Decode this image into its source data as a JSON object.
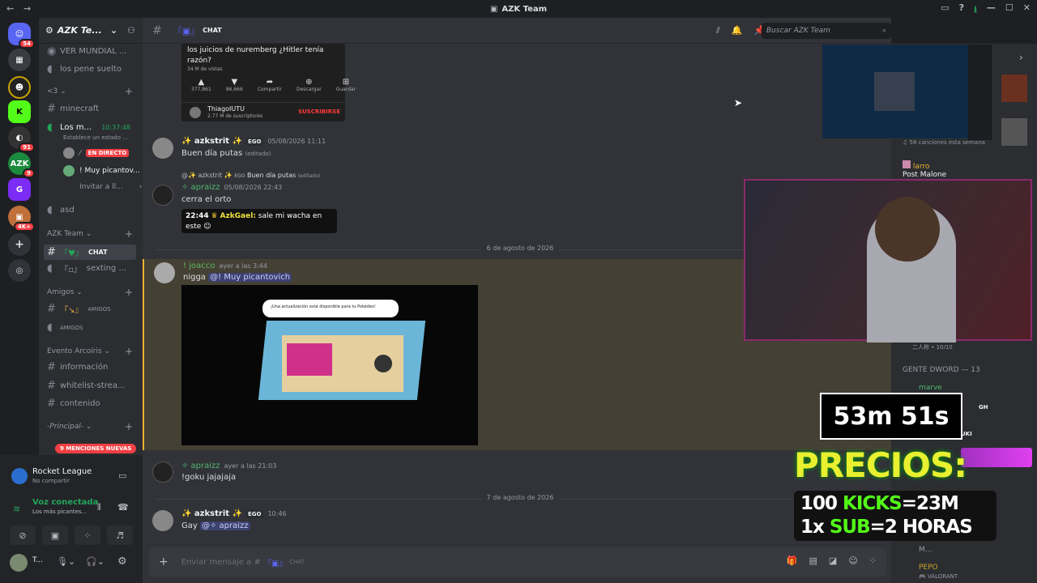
{
  "window": {
    "title": "AZK Team"
  },
  "servers": {
    "dm_badge": "54",
    "badge_91": "91",
    "badge_9": "9",
    "badge_4k": "4K+"
  },
  "sidebar": {
    "server_name": "AZK Te...",
    "channels_top": [
      "VER MUNDIAL ...",
      "los pene suelto"
    ],
    "cat_3": "<3",
    "minecraft": "minecraft",
    "voice_los": "Los m...",
    "voice_time": "10:37:48",
    "voice_status": "Establece un estado ...",
    "en_directo": "EN DIRECTO",
    "muy_pican": "! Muy picantov...",
    "invitar": "Invitar a ll...",
    "asd": "asd",
    "cat_azk": "AZK Team",
    "chat": "CHAT",
    "sexting": "sexting ...",
    "cat_amigos": "Amigos",
    "amigos1": "AMIGOS",
    "amigos2": "AMIGOS",
    "cat_evento": "Evento Arcoíris",
    "informacion": "información",
    "whitelist": "whitelist-strea...",
    "contenido": "contenido",
    "cat_principal": "-Principal-",
    "menciones": "9 MENCIONES NUEVAS"
  },
  "userpanel": {
    "game": "Rocket League",
    "game_sub": "No compartir",
    "voice": "Voz conectada",
    "voice_sub": "Los más picantes...",
    "user": "T..."
  },
  "topbar": {
    "channel": "CHAT",
    "search_placeholder": "Buscar AZK Team"
  },
  "messages": {
    "embed_title": "los juicios de nuremberg ¿Hitler tenía razón?",
    "embed_views": "34 M de vistas",
    "embed_likes": "377,861",
    "embed_dislikes": "86,666",
    "embed_share": "Compartir",
    "embed_download": "Descargar",
    "embed_save": "Guardar",
    "embed_channel": "ThiagoIUTU",
    "embed_subs": "2.77 M de suscriptores",
    "embed_sub_btn": "SUSCRIBIRSE",
    "m1_user": "✨ azkstrit ✨",
    "m1_tag": "EGO",
    "m1_ts": "05/08/2026 11:11",
    "m1_text": "Buen día putas",
    "edited": "(editado)",
    "reply_user": "@✨ azkstrit ✨",
    "reply_tag": "EGO",
    "reply_text": "Buen día putas",
    "m2_user": "✧ apraizz",
    "m2_ts": "05/08/2026 22:43",
    "m2_text": "cerra el orto",
    "m2_sticker_time": "22:44",
    "m2_sticker_user": "AzkGael:",
    "m2_sticker_text": "sale mi wacha en",
    "m2_sticker_text2": "este",
    "date1": "6 de agosto de 2026",
    "m3_user": "! joacco",
    "m3_ts": "ayer a las 3:44",
    "m3_text": "nigga",
    "m3_mention": "@! Muy picantovich",
    "m3_game_dialog": "¡Una actualización está disponible para tu Pokédex!",
    "m4_user": "✧ apraizz",
    "m4_ts": "ayer a las 21:03",
    "m4_text": "!goku jajajaja",
    "date2": "7 de agosto de 2026",
    "m5_user": "✨ azkstrit ✨",
    "m5_tag": "EGO",
    "m5_ts": "10:46",
    "m5_text": "Gay",
    "m5_mention": "@✧ apraizz"
  },
  "composer": {
    "placeholder": "Enviar mensaje a #",
    "channel": "CHAT"
  },
  "members": {
    "songs": "58 canciones esta semana",
    "larro": "larro",
    "post_malone": "Post Malone",
    "nijin": "二人称 • 10/10",
    "gente_dword": "GENTE DWORD — 13",
    "marve": "marve",
    "gh": "GH",
    "uki": "UKI",
    "m": "M...",
    "pepo": "PEPO",
    "valorant": "VALORANT"
  },
  "overlay": {
    "timer": "53m 51s",
    "precios": "PRECIOS:",
    "line1_num": "100",
    "line1_kicks": "KICKS",
    "line1_val": "=23M",
    "line2_num": "1x",
    "line2_sub": "SUB",
    "line2_val": "=2 HORAS"
  }
}
